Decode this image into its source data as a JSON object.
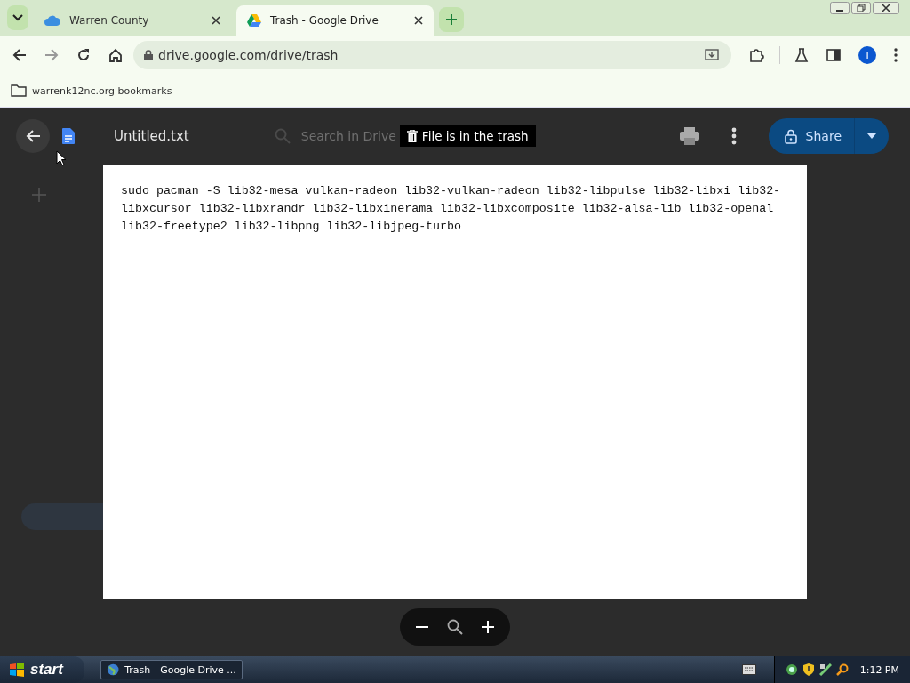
{
  "browser": {
    "tabs": [
      {
        "title": "Warren County",
        "selected": false
      },
      {
        "title": "Trash - Google Drive",
        "selected": true
      }
    ],
    "address": "drive.google.com/drive/trash",
    "profile_initial": "T",
    "bookmarks": [
      "warrenk12nc.org bookmarks"
    ]
  },
  "viewer": {
    "file_name": "Untitled.txt",
    "search_placeholder": "Search in Drive",
    "notice": "File is in the trash",
    "share_label": "Share",
    "content": "sudo pacman -S lib32-mesa vulkan-radeon lib32-vulkan-radeon lib32-libpulse lib32-libxi lib32-libxcursor lib32-libxrandr lib32-libxinerama lib32-libxcomposite lib32-alsa-lib lib32-openal lib32-freetype2 lib32-libpng lib32-libjpeg-turbo"
  },
  "taskbar": {
    "start_label": "start",
    "tasks": [
      {
        "title": "Trash - Google Drive ...",
        "selected": true
      }
    ],
    "clock": "1:12 PM"
  }
}
